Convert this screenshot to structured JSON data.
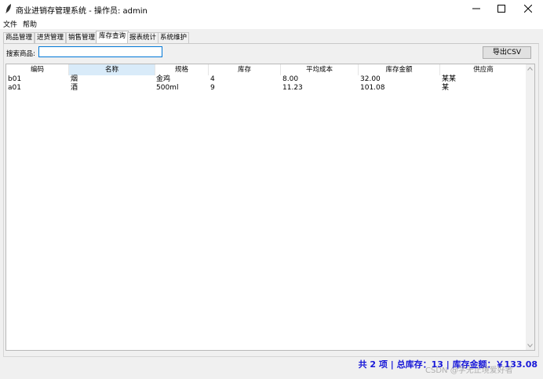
{
  "window": {
    "title": "商业进销存管理系统 - 操作员: admin"
  },
  "menu": [
    "文件",
    "帮助"
  ],
  "tabs": [
    {
      "label": "商品管理",
      "active": false
    },
    {
      "label": "进货管理",
      "active": false
    },
    {
      "label": "销售管理",
      "active": false
    },
    {
      "label": "库存查询",
      "active": true
    },
    {
      "label": "报表统计",
      "active": false
    },
    {
      "label": "系统维护",
      "active": false
    }
  ],
  "search": {
    "label": "搜索商品:",
    "value": ""
  },
  "toolbar": {
    "export_label": "导出CSV"
  },
  "table": {
    "columns": [
      "编码",
      "名称",
      "规格",
      "库存",
      "平均成本",
      "库存金额",
      "供应商"
    ],
    "rows": [
      [
        "b01",
        "烟",
        "金鸡",
        "4",
        "8.00",
        "32.00",
        "某某"
      ],
      [
        "a01",
        "酒",
        "500ml",
        "9",
        "11.23",
        "101.08",
        "某"
      ]
    ]
  },
  "status": {
    "text": "共 2 项 | 总库存：13 | 库存金额：￥133.08"
  },
  "watermark": "CSDN @学无止境爱好者",
  "colors": {
    "accent": "#0078d7",
    "status_text": "#1818d8",
    "header_highlight": "#d9ebf9"
  }
}
